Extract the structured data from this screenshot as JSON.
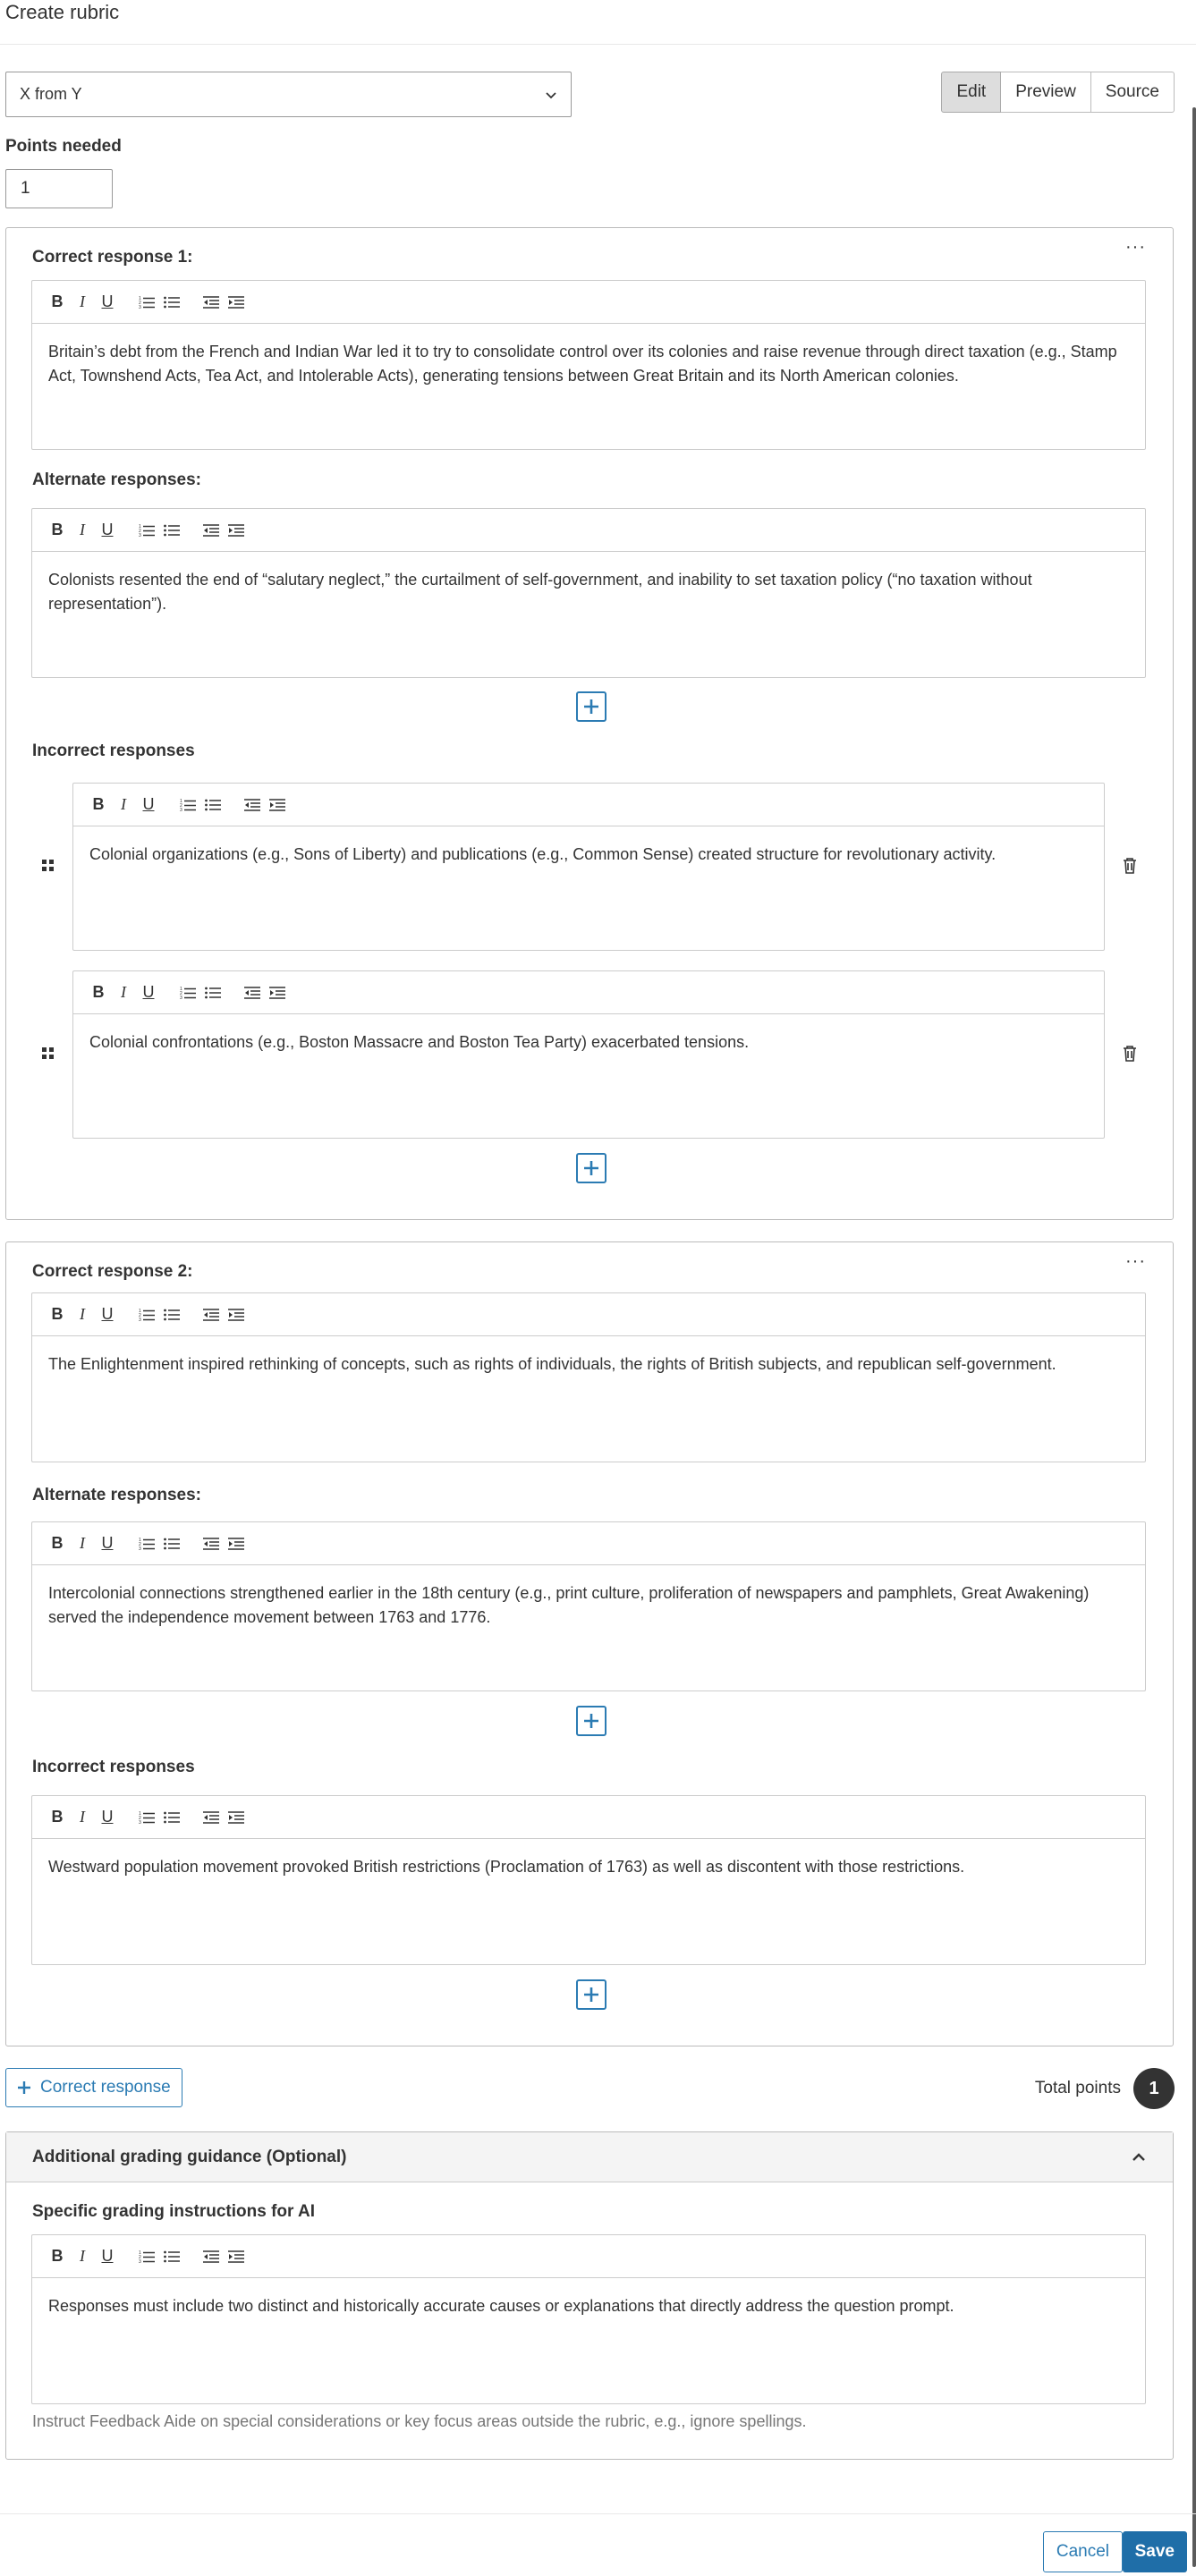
{
  "page": {
    "title": "Create rubric"
  },
  "colors": {
    "accent": "#2b7bb3",
    "save_bg": "#1f6ea8",
    "scroll_thumb": "#5b5b5b",
    "badge_bg": "#333333"
  },
  "selector": {
    "value": "X from Y"
  },
  "view_toggle": {
    "edit": "Edit",
    "preview": "Preview",
    "source": "Source",
    "active": "Edit"
  },
  "points": {
    "label": "Points needed",
    "value": "1"
  },
  "toolbar_icons": [
    "bold-icon",
    "italic-icon",
    "underline-icon",
    "numbered-list-icon",
    "bulleted-list-icon",
    "outdent-icon",
    "indent-icon"
  ],
  "toolbar": {
    "bold": "B",
    "italic": "I",
    "underline": "U"
  },
  "labels": {
    "alternate": "Alternate responses:",
    "incorrect": "Incorrect responses"
  },
  "cards": [
    {
      "title": "Correct response 1:",
      "correct": "Britain’s debt from the French and Indian War led it to try to consolidate control over its colonies and raise revenue through direct taxation (e.g., Stamp Act, Townshend Acts, Tea Act, and Intolerable Acts), generating tensions between Great Britain and its North American colonies.",
      "alternates": [
        "Colonists resented the end of “salutary neglect,” the curtailment of self-government, and inability to set taxation policy (“no taxation without representation”)."
      ],
      "incorrect": [
        "Colonial organizations (e.g., Sons of Liberty) and publications (e.g., Common Sense) created structure for revolutionary activity.",
        "Colonial confrontations (e.g., Boston Massacre and Boston Tea Party) exacerbated tensions."
      ]
    },
    {
      "title": "Correct response 2:",
      "correct": "The Enlightenment inspired rethinking of concepts, such as rights of individuals, the rights of British subjects, and republican self-government.",
      "alternates": [
        "Intercolonial connections strengthened earlier in the 18th century (e.g., print culture, proliferation of newspapers and pamphlets, Great Awakening) served the independence movement between 1763 and 1776."
      ],
      "incorrect": [
        "Westward population movement provoked British restrictions (Proclamation of 1763) as well as discontent with those restrictions."
      ]
    }
  ],
  "add_correct": {
    "label": "Correct response"
  },
  "total": {
    "label": "Total points",
    "value": "1"
  },
  "guidance": {
    "header": "Additional grading guidance (Optional)",
    "label": "Specific grading instructions for AI",
    "text": "Responses must include two distinct and historically accurate causes or explanations that directly address the question prompt.",
    "hint": "Instruct Feedback Aide on special considerations or key focus areas outside the rubric, e.g., ignore spellings."
  },
  "footer": {
    "cancel": "Cancel",
    "save": "Save"
  }
}
